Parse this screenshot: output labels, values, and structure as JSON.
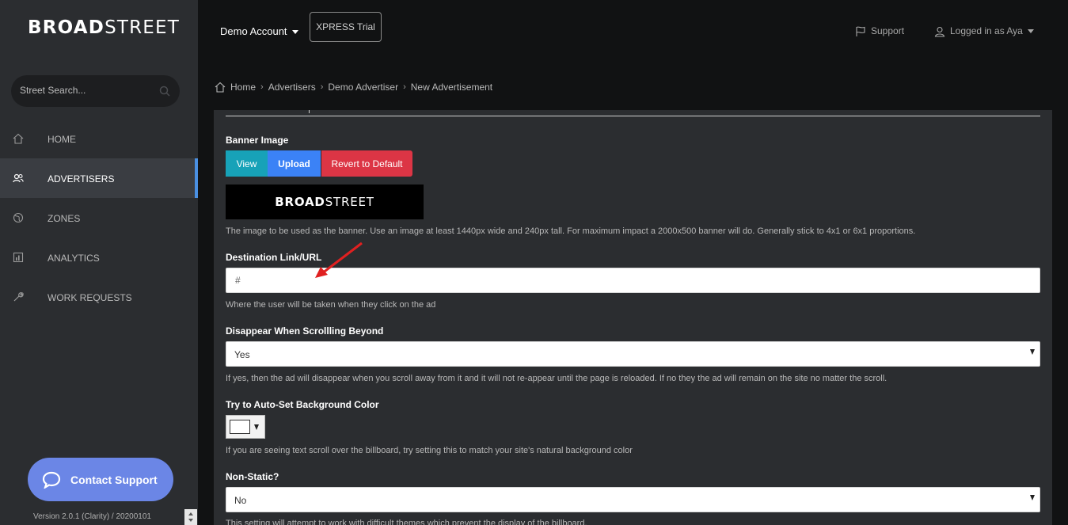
{
  "brand": {
    "bold": "BROAD",
    "light": "STREET"
  },
  "search": {
    "placeholder": "Street Search..."
  },
  "nav": [
    {
      "label": "HOME",
      "icon": "home-icon"
    },
    {
      "label": "ADVERTISERS",
      "icon": "users-icon",
      "active": true
    },
    {
      "label": "ZONES",
      "icon": "globe-icon"
    },
    {
      "label": "ANALYTICS",
      "icon": "chart-icon"
    },
    {
      "label": "WORK REQUESTS",
      "icon": "wrench-icon"
    }
  ],
  "contact": {
    "label": "Contact Support"
  },
  "version": "Version 2.0.1 (Clarity) / 20200101",
  "topbar": {
    "account": "Demo Account",
    "trial": "XPRESS Trial",
    "support": "Support",
    "login": "Logged in as Aya"
  },
  "breadcrumb": [
    "Home",
    "Advertisers",
    "Demo Advertiser",
    "New Advertisement"
  ],
  "form": {
    "banner": {
      "label": "Banner Image",
      "view": "View",
      "upload": "Upload",
      "revert": "Revert to Default",
      "preview_bold": "BROAD",
      "preview_light": "STREET",
      "help": "The image to be used as the banner. Use an image at least 1440px wide and 240px tall. For maximum impact a 2000x500 banner will do. Generally stick to 4x1 or 6x1 proportions."
    },
    "destination": {
      "label": "Destination Link/URL",
      "value": "#",
      "help": "Where the user will be taken when they click on the ad"
    },
    "disappear": {
      "label": "Disappear When Scrollling Beyond",
      "value": "Yes",
      "help": "If yes, then the ad will disappear when you scroll away from it and it will not re-appear until the page is reloaded. If no they the ad will remain on the site no matter the scroll."
    },
    "autoset": {
      "label": "Try to Auto-Set Background Color",
      "color": "#ffffff",
      "help": "If you are seeing text scroll over the billboard, try setting this to match your site's natural background color"
    },
    "nonstatic": {
      "label": "Non-Static?",
      "value": "No",
      "help": "This setting will attempt to work with difficult themes which prevent the display of the billboard."
    }
  },
  "colors": {
    "accent": "#4a90e2",
    "view": "#17a2b8",
    "upload": "#3b82f6",
    "revert": "#dc3545",
    "contact": "#6b86e6",
    "annotation": "#e02020"
  }
}
